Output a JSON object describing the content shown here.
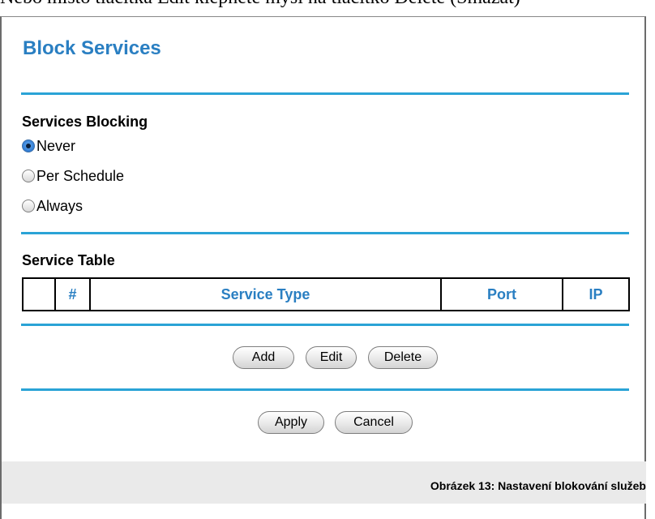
{
  "top_text": "Nebo místo tlačítka Edit klepněte myší na tlačítko Delete (Smazat)",
  "title": "Block Services",
  "services_blocking": {
    "label": "Services Blocking",
    "options": [
      {
        "label": "Never",
        "checked": true
      },
      {
        "label": "Per Schedule",
        "checked": false
      },
      {
        "label": "Always",
        "checked": false
      }
    ]
  },
  "service_table": {
    "label": "Service Table",
    "columns": [
      "",
      "#",
      "Service Type",
      "Port",
      "IP"
    ]
  },
  "table_buttons": {
    "add": "Add",
    "edit": "Edit",
    "delete": "Delete"
  },
  "form_buttons": {
    "apply": "Apply",
    "cancel": "Cancel"
  },
  "caption": "Obrázek 13: Nastavení blokování služeb"
}
